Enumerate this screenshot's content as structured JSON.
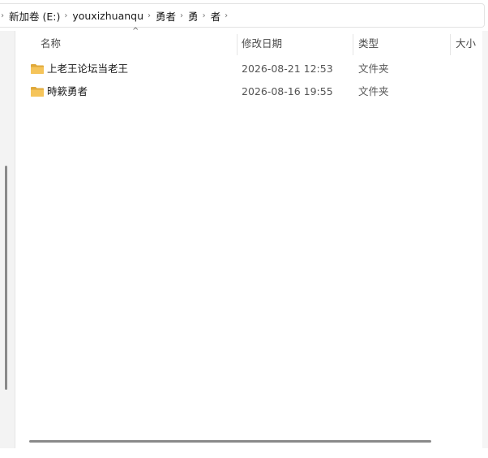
{
  "breadcrumb": {
    "items": [
      "新加卷 (E:)",
      "youxizhuanqu",
      "勇者",
      "勇",
      "者"
    ]
  },
  "columns": {
    "name": "名称",
    "date": "修改日期",
    "type": "类型",
    "size": "大小",
    "sort": {
      "column": "名称",
      "direction": "ascending"
    }
  },
  "files": [
    {
      "name": "上老王论坛当老王",
      "modified": "2026-08-21 12:53",
      "type": "文件夹",
      "icon": "folder-icon"
    },
    {
      "name": "時簌勇者",
      "modified": "2026-08-16 19:55",
      "type": "文件夹",
      "icon": "folder-icon"
    }
  ],
  "colors": {
    "folder": "#f5c45a",
    "folder_dark": "#e0a93a",
    "selection": "#cce8ff"
  }
}
